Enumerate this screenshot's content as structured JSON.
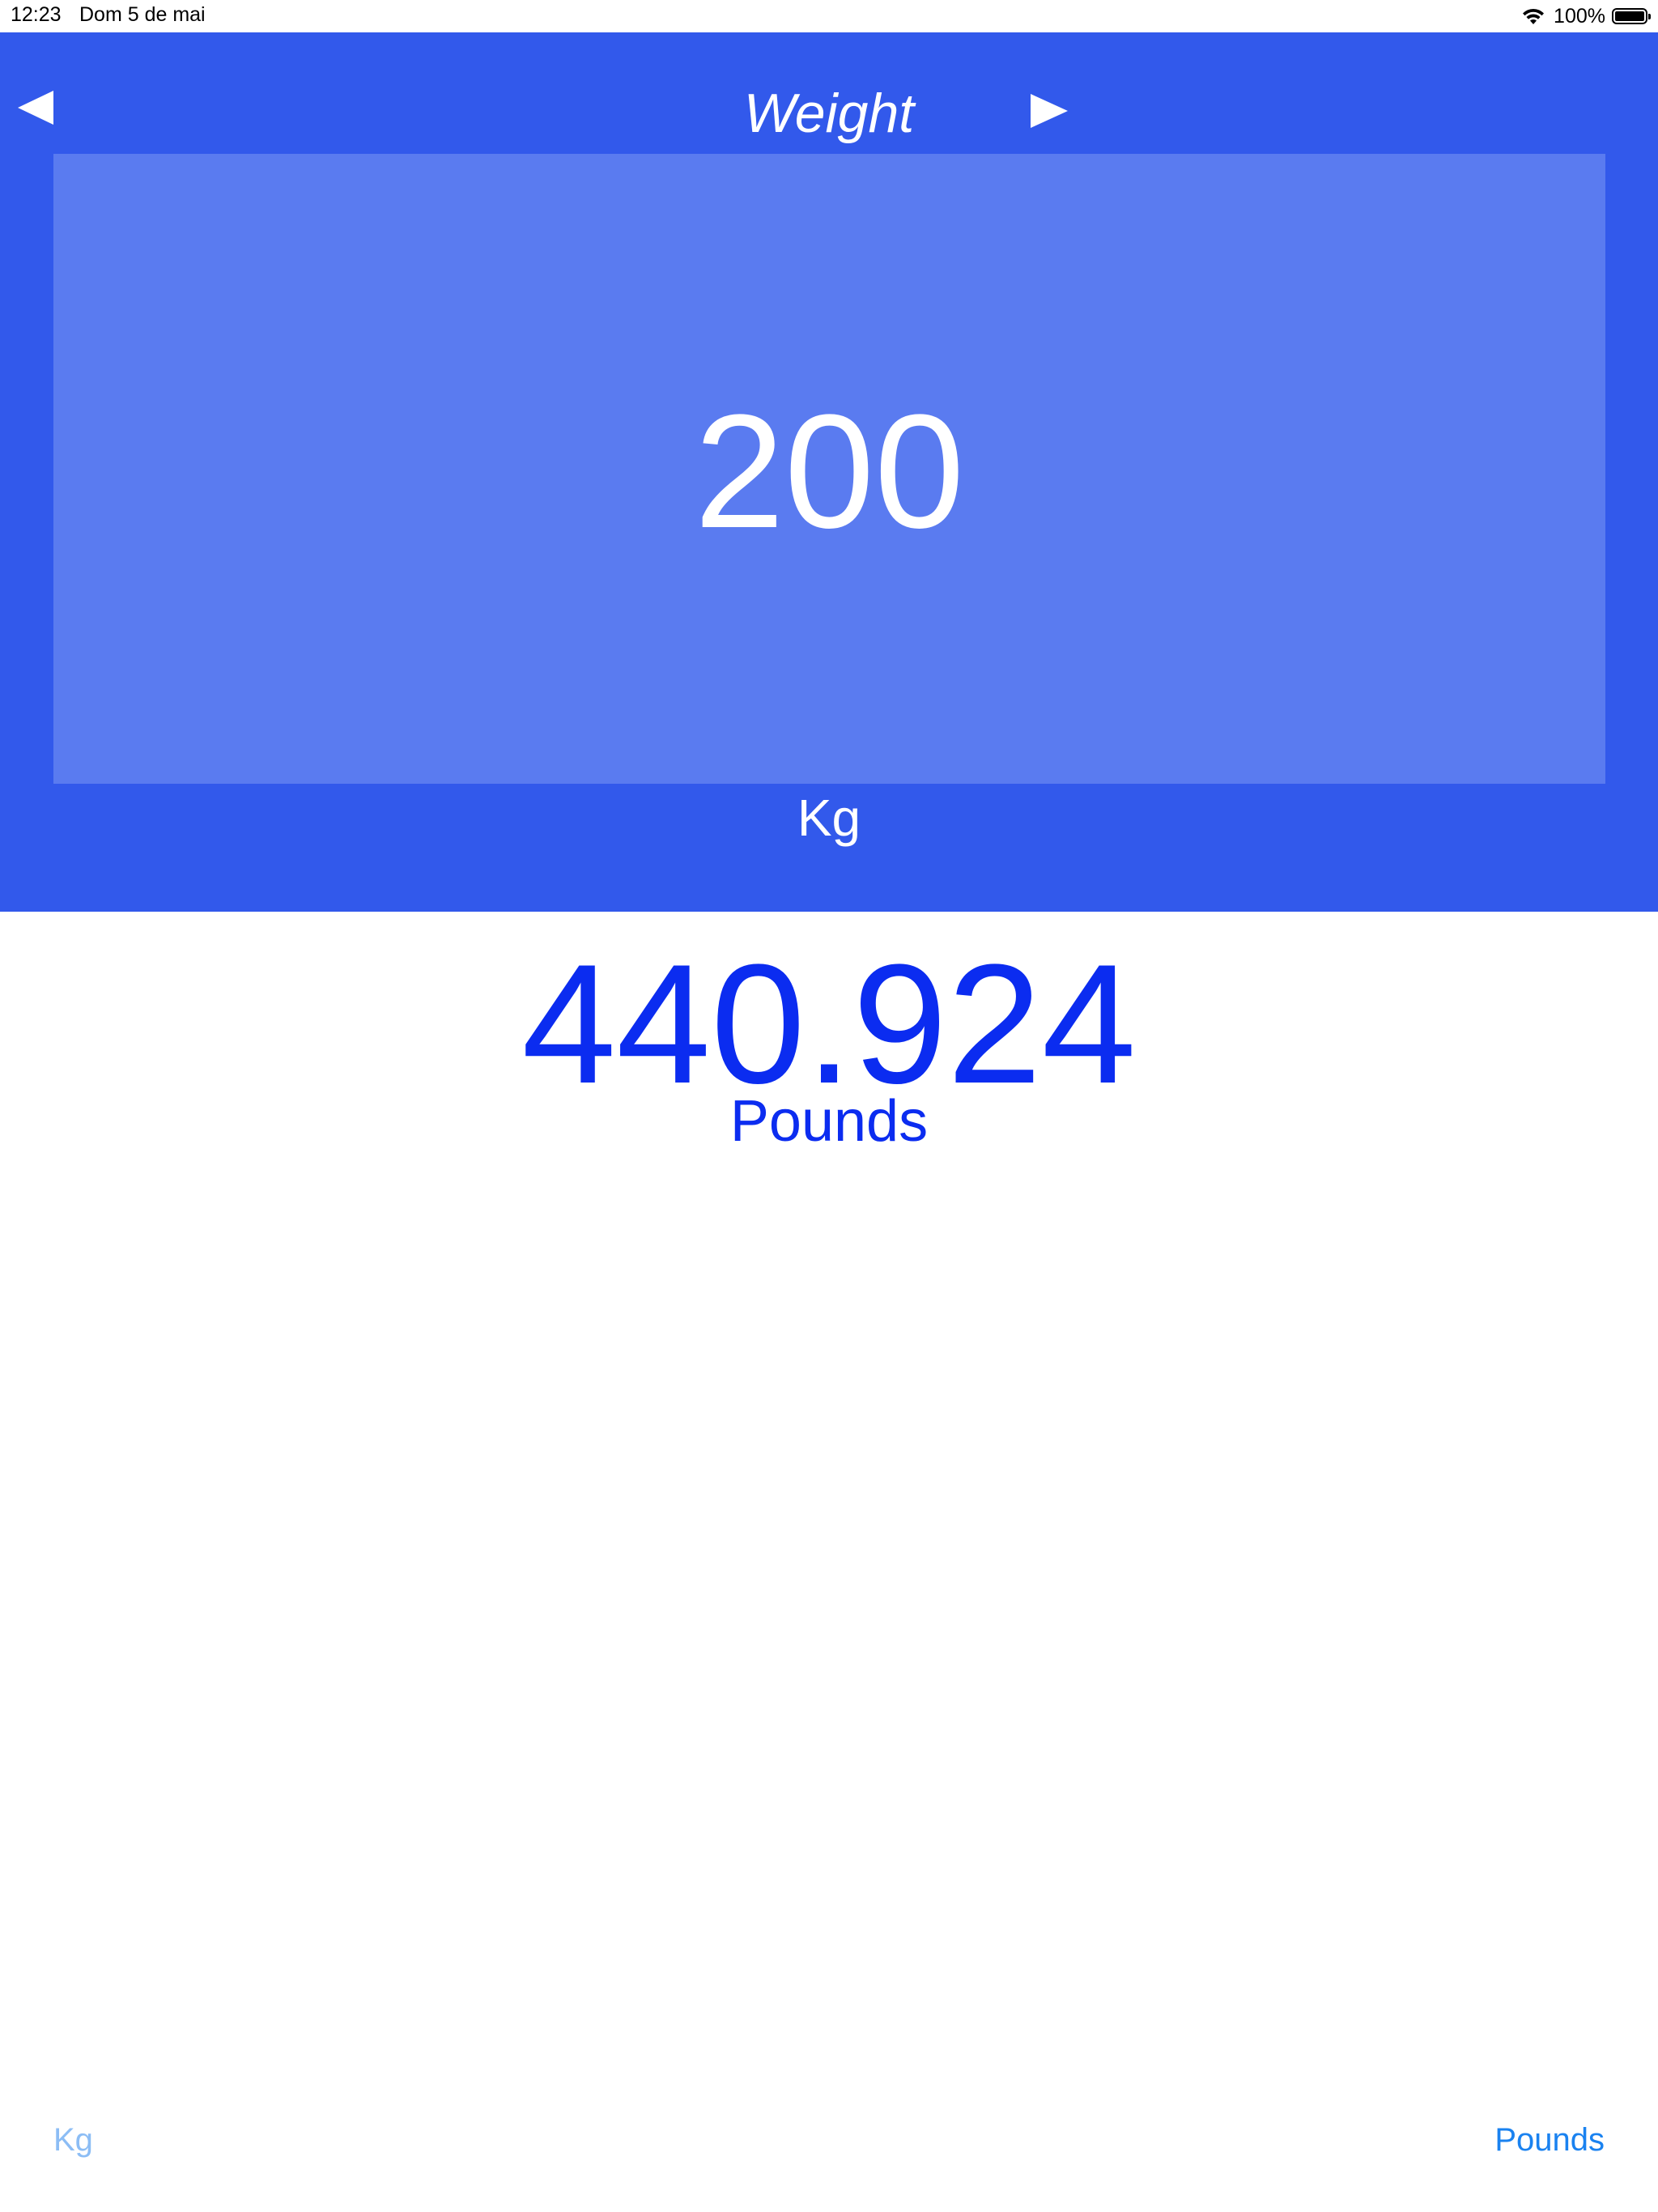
{
  "status_bar": {
    "time": "12:23",
    "date": "Dom 5 de mai",
    "battery": "100%",
    "icons": [
      "wifi-icon",
      "battery-icon"
    ]
  },
  "header": {
    "title": "Weight",
    "prev_icon": "triangle-left-icon",
    "next_icon": "triangle-right-icon"
  },
  "input": {
    "value": "200",
    "unit": "Kg"
  },
  "result": {
    "value": "440.924",
    "unit": "Pounds"
  },
  "bottom": {
    "left_unit": "Kg",
    "right_unit": "Pounds"
  },
  "colors": {
    "header_bg": "#3259eb",
    "input_box_bg": "#5a7bf0",
    "result_text": "#0b2cf0",
    "bottom_left_text": "#8cbdf5",
    "bottom_right_text": "#1a82f0"
  }
}
